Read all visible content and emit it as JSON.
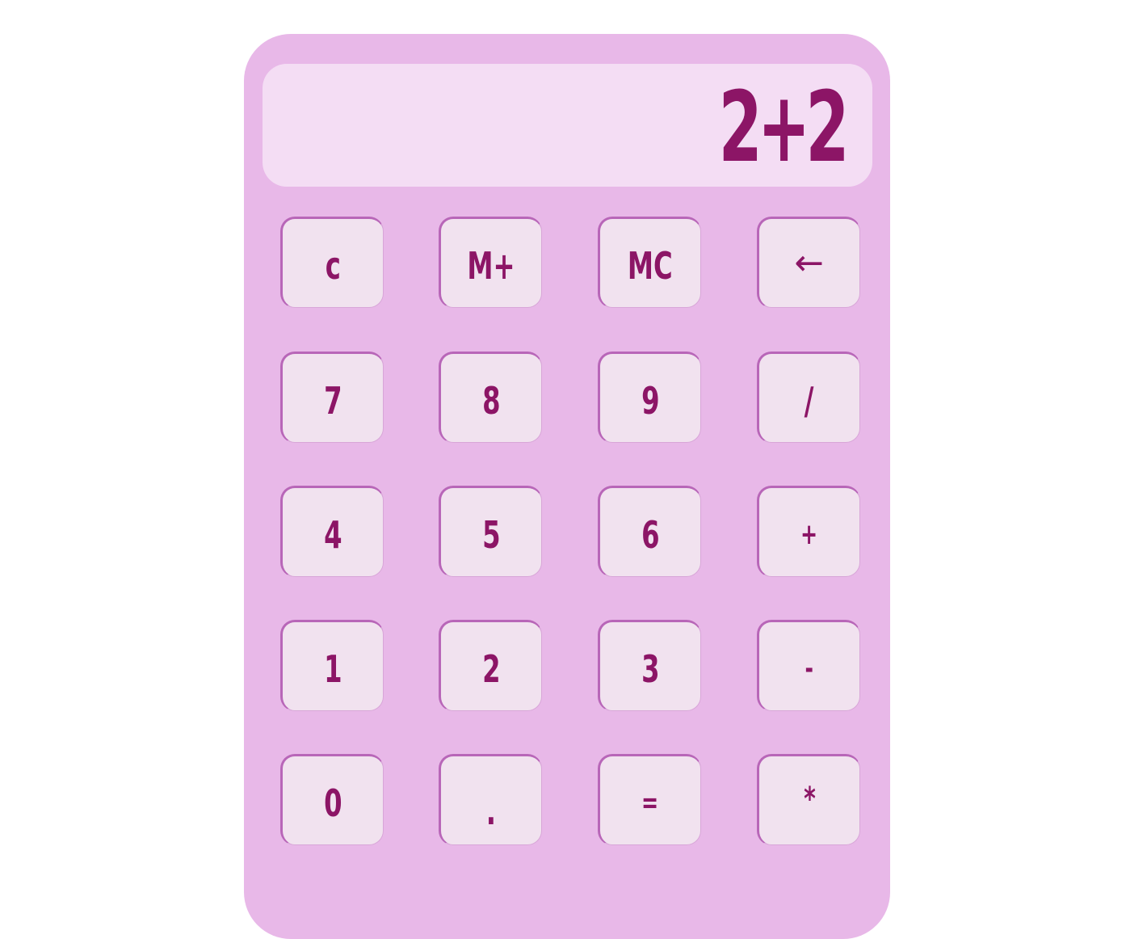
{
  "display": {
    "value": "2+2"
  },
  "keys": [
    {
      "label": "c",
      "name": "clear-button"
    },
    {
      "label": "M+",
      "name": "memory-add-button"
    },
    {
      "label": "MC",
      "name": "memory-clear-button"
    },
    {
      "label": "←",
      "name": "backspace-button"
    },
    {
      "label": "7",
      "name": "digit-7-button"
    },
    {
      "label": "8",
      "name": "digit-8-button"
    },
    {
      "label": "9",
      "name": "digit-9-button"
    },
    {
      "label": "/",
      "name": "divide-button"
    },
    {
      "label": "4",
      "name": "digit-4-button"
    },
    {
      "label": "5",
      "name": "digit-5-button"
    },
    {
      "label": "6",
      "name": "digit-6-button"
    },
    {
      "label": "+",
      "name": "add-button"
    },
    {
      "label": "1",
      "name": "digit-1-button"
    },
    {
      "label": "2",
      "name": "digit-2-button"
    },
    {
      "label": "3",
      "name": "digit-3-button"
    },
    {
      "label": "-",
      "name": "subtract-button"
    },
    {
      "label": "0",
      "name": "digit-0-button"
    },
    {
      "label": ".",
      "name": "decimal-point-button"
    },
    {
      "label": "=",
      "name": "equals-button"
    },
    {
      "label": "*",
      "name": "multiply-button"
    }
  ],
  "colors": {
    "body": "#e8b8e8",
    "display_background": "#f4ddf4",
    "key_background": "#f1e2ef",
    "key_border": "#b866b8",
    "text": "#8c1566"
  }
}
